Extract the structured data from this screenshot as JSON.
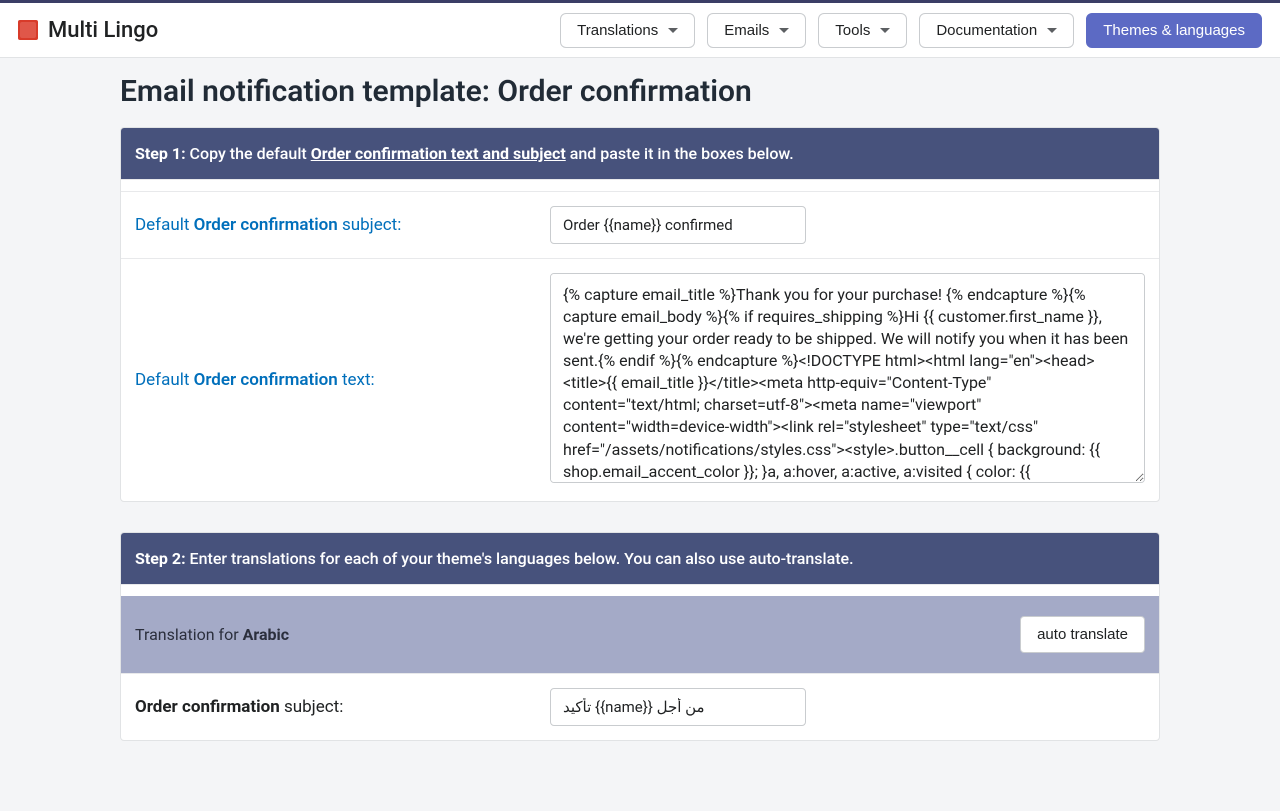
{
  "brand": {
    "name": "Multi Lingo"
  },
  "nav": {
    "items": [
      {
        "label": "Translations"
      },
      {
        "label": "Emails"
      },
      {
        "label": "Tools"
      },
      {
        "label": "Documentation"
      }
    ],
    "primary": "Themes & languages"
  },
  "page_title": "Email notification template: Order confirmation",
  "step1": {
    "label": "Step 1:",
    "prefix": " Copy the default ",
    "link": "Order confirmation text and subject",
    "suffix": " and paste it in the boxes below."
  },
  "defaults": {
    "subject_label_pre": "Default ",
    "subject_label_link": "Order confirmation",
    "subject_label_post": " subject:",
    "subject_value": "Order {{name}} confirmed",
    "text_label_pre": "Default ",
    "text_label_link": "Order confirmation",
    "text_label_post": " text:",
    "text_value": "{% capture email_title %}Thank you for your purchase! {% endcapture %}{% capture email_body %}{% if requires_shipping %}Hi {{ customer.first_name }}, we're getting your order ready to be shipped. We will notify you when it has been sent.{% endif %}{% endcapture %}<!DOCTYPE html><html lang=\"en\"><head> <title>{{ email_title }}</title><meta http-equiv=\"Content-Type\" content=\"text/html; charset=utf-8\"><meta name=\"viewport\" content=\"width=device-width\"><link rel=\"stylesheet\" type=\"text/css\" href=\"/assets/notifications/styles.css\"><style>.button__cell { background: {{ shop.email_accent_color }}; }a, a:hover, a:active, a:visited { color: {{ shop.email_accent_color }}; }</style></head><body><table class=\"body\"><tr> <td><table class=\"header row\"><tr><td class=\"header__cell\"><center><table"
  },
  "step2": {
    "label": "Step 2:",
    "text": " Enter translations for each of your theme's languages below. You can also use auto-translate."
  },
  "translation": {
    "header_prefix": "Translation for ",
    "language": "Arabic",
    "auto_btn": "auto translate",
    "subject_label_name": "Order confirmation",
    "subject_label_suffix": " subject:",
    "subject_value": "من أجل {{name}} تأكيد"
  }
}
